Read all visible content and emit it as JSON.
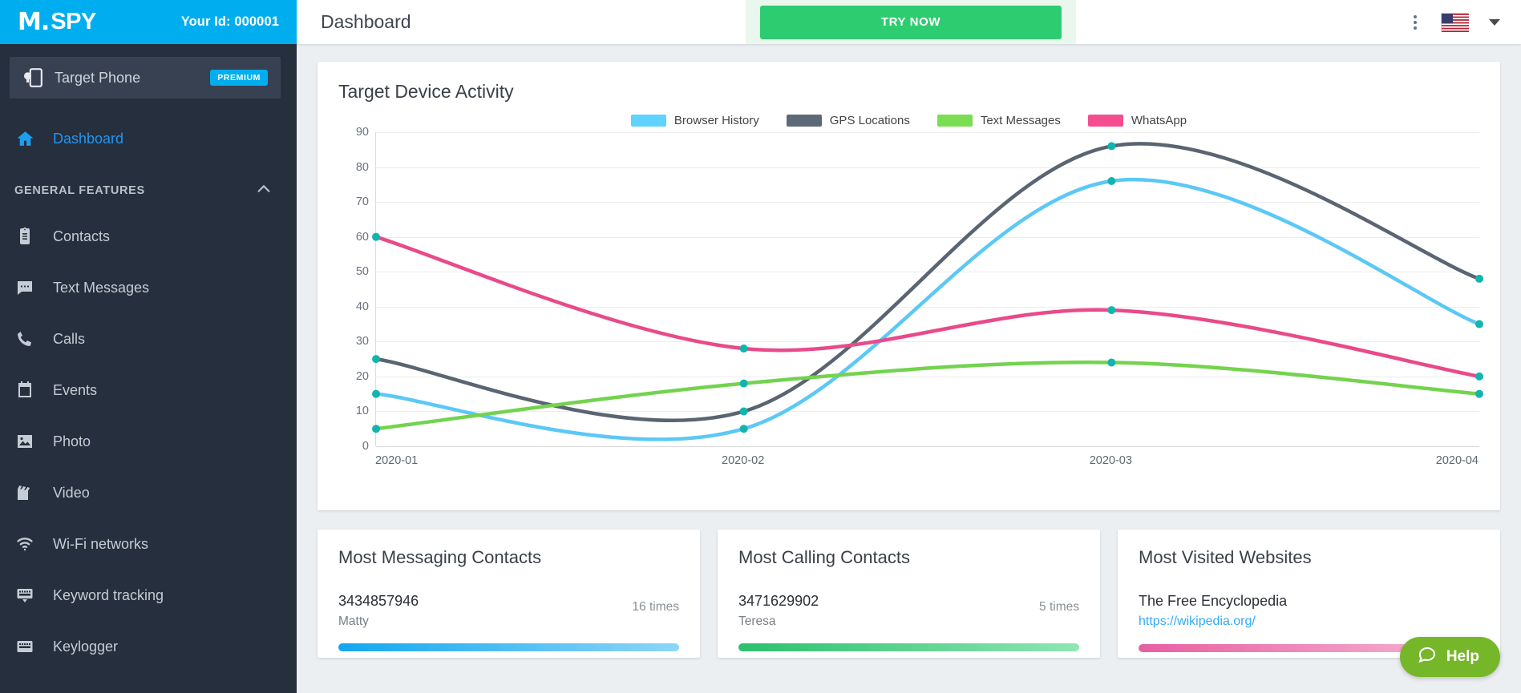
{
  "brand": {
    "logo_mark": "M.",
    "logo_text": "SPY",
    "your_id": "Your Id: 000001"
  },
  "sidebar": {
    "target_phone": {
      "label": "Target Phone",
      "badge": "PREMIUM",
      "icon": "phone-settings-icon"
    },
    "dashboard": {
      "label": "Dashboard",
      "icon": "home-icon"
    },
    "section": {
      "title": "GENERAL FEATURES",
      "chevron": "chevron-up-icon"
    },
    "items": [
      {
        "label": "Contacts",
        "icon": "contacts-icon"
      },
      {
        "label": "Text Messages",
        "icon": "message-icon"
      },
      {
        "label": "Calls",
        "icon": "phone-icon"
      },
      {
        "label": "Events",
        "icon": "calendar-icon"
      },
      {
        "label": "Photo",
        "icon": "image-icon"
      },
      {
        "label": "Video",
        "icon": "video-icon"
      },
      {
        "label": "Wi-Fi networks",
        "icon": "wifi-icon"
      },
      {
        "label": "Keyword tracking",
        "icon": "keyword-icon"
      },
      {
        "label": "Keylogger",
        "icon": "keyboard-icon"
      }
    ]
  },
  "topbar": {
    "page_title": "Dashboard",
    "try_now": "TRY NOW",
    "kebab": "more-vertical-icon",
    "flag": "us-flag-icon",
    "caret": "chevron-down-icon"
  },
  "chart_data": {
    "type": "line",
    "title": "Target Device Activity",
    "xlabel": "",
    "ylabel": "",
    "x": [
      "2020-01",
      "2020-02",
      "2020-03",
      "2020-04"
    ],
    "categories": [
      "2020-01",
      "2020-02",
      "2020-03",
      "2020-04"
    ],
    "ylim": [
      0,
      90
    ],
    "yticks": [
      0,
      10,
      20,
      30,
      40,
      50,
      60,
      70,
      80,
      90
    ],
    "grid": true,
    "legend_position": "top-center",
    "marker_color": "#11b5ae",
    "series": [
      {
        "name": "Browser History",
        "color": "#5bc8f5",
        "values": [
          15,
          5,
          76,
          35
        ]
      },
      {
        "name": "GPS Locations",
        "color": "#5a6472",
        "values": [
          25,
          10,
          86,
          48
        ]
      },
      {
        "name": "Text Messages",
        "color": "#73d34e",
        "values": [
          5,
          18,
          24,
          15
        ]
      },
      {
        "name": "WhatsApp",
        "color": "#e84a8a",
        "values": [
          60,
          28,
          39,
          20
        ]
      }
    ]
  },
  "cards": [
    {
      "title": "Most Messaging Contacts",
      "primary": "3434857946",
      "secondary": "Matty",
      "count": "16 times",
      "bar_class": "bar-blue",
      "bar_width": "100%"
    },
    {
      "title": "Most Calling Contacts",
      "primary": "3471629902",
      "secondary": "Teresa",
      "count": "5 times",
      "bar_class": "bar-green",
      "bar_width": "100%"
    },
    {
      "title": "Most Visited Websites",
      "primary": "The Free Encyclopedia",
      "link": "https://wikipedia.org/",
      "count": "",
      "bar_class": "bar-pink",
      "bar_width": "100%"
    }
  ],
  "help": {
    "label": "Help",
    "icon": "chat-bubble-icon"
  }
}
